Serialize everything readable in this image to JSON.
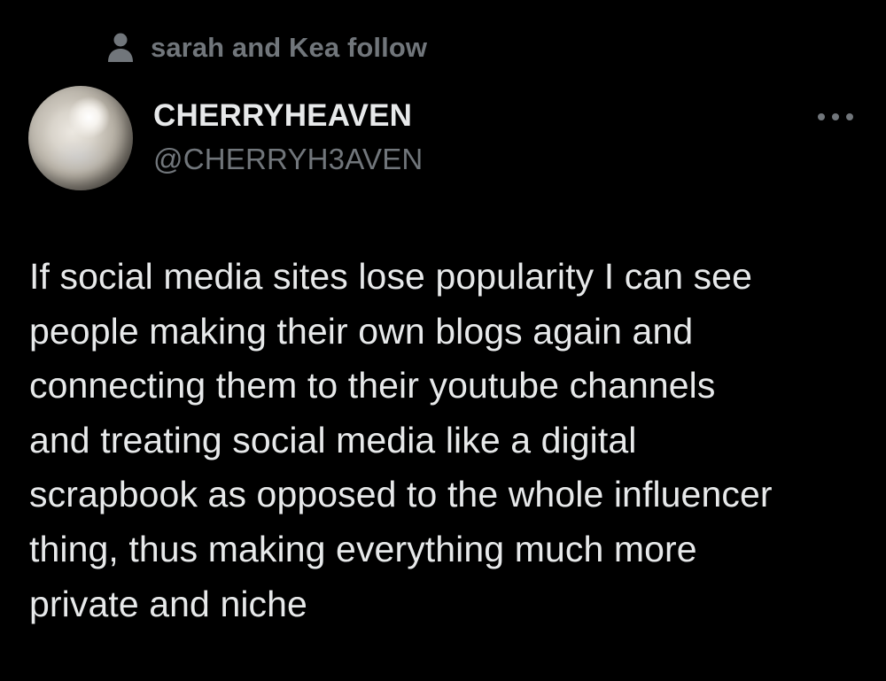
{
  "social_context": {
    "text": "sarah and Kea follow",
    "icon": "person-icon"
  },
  "author": {
    "display_name": "CHERRYHEAVEN",
    "handle": "@CHERRYH3AVEN",
    "avatar": "pearl-avatar"
  },
  "more_menu": {
    "icon": "more-horizontal-icon"
  },
  "tweet": {
    "lines": [
      "If social media sites lose popularity I can see",
      "people making their own blogs again and",
      "connecting them to their youtube channels",
      "and treating social media like a digital",
      "scrapbook as opposed to the whole influencer",
      "thing, thus making everything much more",
      "private and niche"
    ]
  },
  "colors": {
    "background": "#000000",
    "primary_text": "#e7e9ea",
    "secondary_text": "#71767b"
  }
}
